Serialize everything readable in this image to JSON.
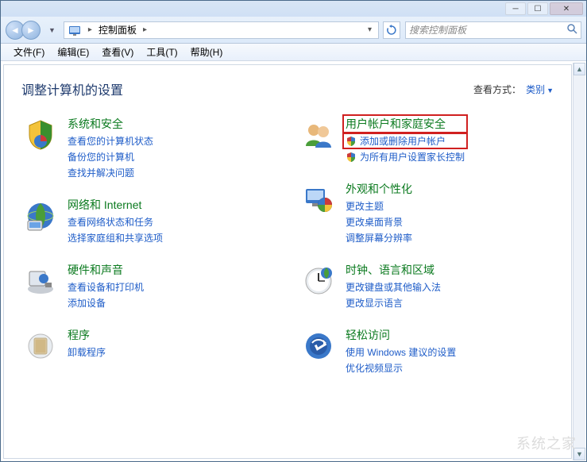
{
  "window": {
    "breadcrumb_root": "控制面板",
    "search_placeholder": "搜索控制面板"
  },
  "menu": {
    "file": "文件(F)",
    "edit": "编辑(E)",
    "view": "查看(V)",
    "tools": "工具(T)",
    "help": "帮助(H)"
  },
  "page": {
    "title": "调整计算机的设置",
    "view_label": "查看方式：",
    "view_mode": "类别"
  },
  "categories": {
    "left": [
      {
        "title": "系统和安全",
        "links": [
          {
            "text": "查看您的计算机状态"
          },
          {
            "text": "备份您的计算机"
          },
          {
            "text": "查找并解决问题"
          }
        ]
      },
      {
        "title": "网络和 Internet",
        "links": [
          {
            "text": "查看网络状态和任务"
          },
          {
            "text": "选择家庭组和共享选项"
          }
        ]
      },
      {
        "title": "硬件和声音",
        "links": [
          {
            "text": "查看设备和打印机"
          },
          {
            "text": "添加设备"
          }
        ]
      },
      {
        "title": "程序",
        "links": [
          {
            "text": "卸载程序"
          }
        ]
      }
    ],
    "right": [
      {
        "title": "用户帐户和家庭安全",
        "links": [
          {
            "text": "添加或删除用户帐户",
            "shield": true,
            "highlight": true
          },
          {
            "text": "为所有用户设置家长控制",
            "shield": true
          }
        ]
      },
      {
        "title": "外观和个性化",
        "links": [
          {
            "text": "更改主题"
          },
          {
            "text": "更改桌面背景"
          },
          {
            "text": "调整屏幕分辨率"
          }
        ]
      },
      {
        "title": "时钟、语言和区域",
        "links": [
          {
            "text": "更改键盘或其他输入法"
          },
          {
            "text": "更改显示语言"
          }
        ]
      },
      {
        "title": "轻松访问",
        "links": [
          {
            "text": "使用 Windows 建议的设置"
          },
          {
            "text": "优化视频显示"
          }
        ]
      }
    ]
  },
  "watermark": "系统之家"
}
